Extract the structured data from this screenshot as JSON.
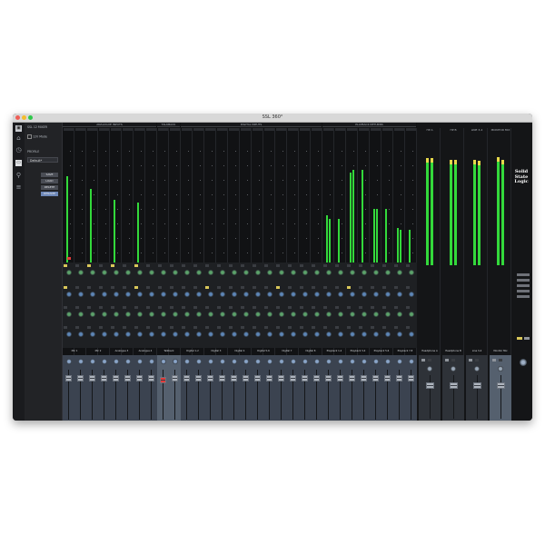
{
  "window": {
    "title": "SSL 360°"
  },
  "sidebar": {
    "header": "SSL 12 MIXER",
    "mode": "12V Mode",
    "profile_label": "PROFILE",
    "profile_value": "Default*",
    "buttons": [
      "SAVE",
      "LOAD",
      "DELETE",
      "RENAME"
    ],
    "selected_button": 3
  },
  "groups": [
    {
      "label": "ANALOGUE INPUTS",
      "first": 0,
      "count": 4
    },
    {
      "label": "TALKBACK",
      "first": 4,
      "count": 1
    },
    {
      "label": "DIGITAL INPUTS",
      "first": 5,
      "count": 6
    },
    {
      "label": "PLAYBACK RETURNS",
      "first": 11,
      "count": 4
    }
  ],
  "input_channels": [
    {
      "label": "Mic 1",
      "meter": [
        0.82,
        0.0
      ],
      "red": true
    },
    {
      "label": "Mic 2",
      "meter": [
        0.7,
        0.0
      ],
      "red": false
    },
    {
      "label": "Analogue 3",
      "meter": [
        0.6,
        0.0
      ],
      "red": false
    },
    {
      "label": "Analogue 4",
      "meter": [
        0.58,
        0.0
      ],
      "red": false
    },
    {
      "label": "Talkback",
      "meter": [
        0.0,
        0.0
      ],
      "red": false
    },
    {
      "label": "Digital 1-2",
      "meter": [
        0.0,
        0.0
      ],
      "red": false
    },
    {
      "label": "Digital 3",
      "meter": [
        0.0,
        0.0
      ],
      "red": false
    },
    {
      "label": "Digital 4",
      "meter": [
        0.0,
        0.0
      ],
      "red": false
    },
    {
      "label": "Digital 5-6",
      "meter": [
        0.0,
        0.0
      ],
      "red": false
    },
    {
      "label": "Digital 7",
      "meter": [
        0.0,
        0.0
      ],
      "red": false
    },
    {
      "label": "Digital 8",
      "meter": [
        0.0,
        0.0
      ],
      "red": false
    },
    {
      "label": "Playback 1-2",
      "meter": [
        0.46,
        0.42
      ],
      "red": false
    },
    {
      "label": "Playback 3-4",
      "meter": [
        0.86,
        0.88
      ],
      "red": false
    },
    {
      "label": "Playback 5-6",
      "meter": [
        0.52,
        0.52
      ],
      "red": false
    },
    {
      "label": "Playback 7-8",
      "meter": [
        0.34,
        0.32
      ],
      "red": false
    }
  ],
  "output_channels": [
    {
      "header": "HP A",
      "label": "Headphone A",
      "meter": [
        0.92,
        0.92
      ]
    },
    {
      "header": "HP B",
      "label": "Headphone B",
      "meter": [
        0.91,
        0.91
      ]
    },
    {
      "header": "LINE 3-4",
      "label": "Line 3-4",
      "meter": [
        0.91,
        0.9
      ]
    },
    {
      "header": "MONITOR MIX",
      "label": "Monitor Mix",
      "meter": [
        0.93,
        0.91
      ]
    }
  ],
  "logo": {
    "line1": "Solid",
    "line2": "State",
    "line3": "Logic"
  },
  "colors": {
    "meter": "#33d93b",
    "peak_yellow": "#e6d84a",
    "knob_green": "#5ca36a",
    "knob_blue": "#5d86b8",
    "clip_red": "#e23a3a"
  },
  "icons": [
    "app-icon",
    "home-icon",
    "clock-icon",
    "mixer-icon",
    "link-icon",
    "settings-sliders-icon"
  ]
}
